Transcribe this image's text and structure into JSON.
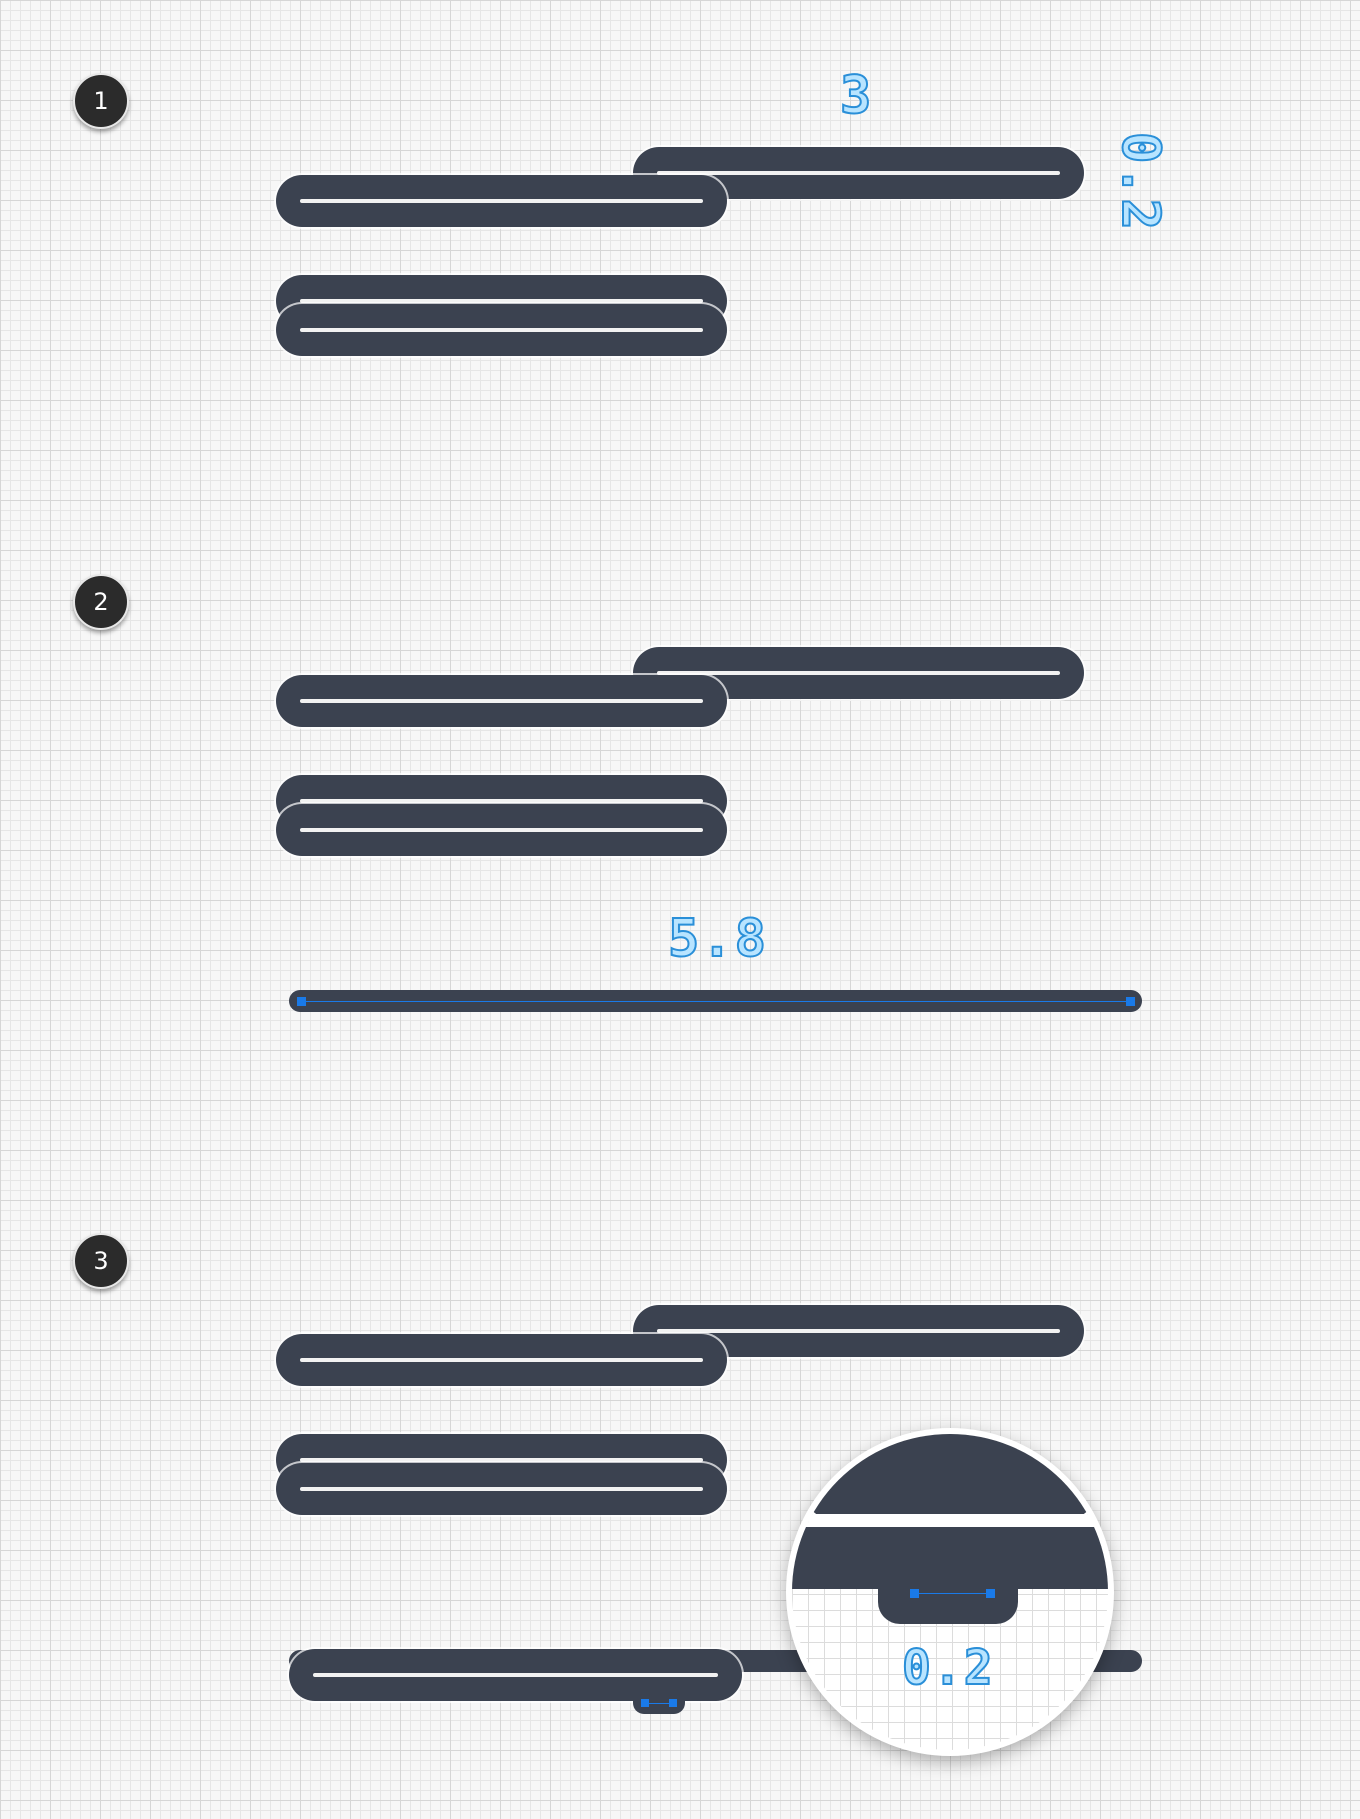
{
  "steps": [
    {
      "number": "1"
    },
    {
      "number": "2"
    },
    {
      "number": "3"
    }
  ],
  "dimensions": {
    "bar_width": "3",
    "bar_height": "0.2",
    "guide_length": "5.8",
    "small_width": "0.2"
  },
  "colors": {
    "bar": "#3b4250",
    "highlight": "#f2f2f2",
    "anchor": "#1a7ae8",
    "label_fill": "#b8e4ff",
    "label_stroke": "#2a8fd8",
    "badge": "#2b2b2b"
  }
}
